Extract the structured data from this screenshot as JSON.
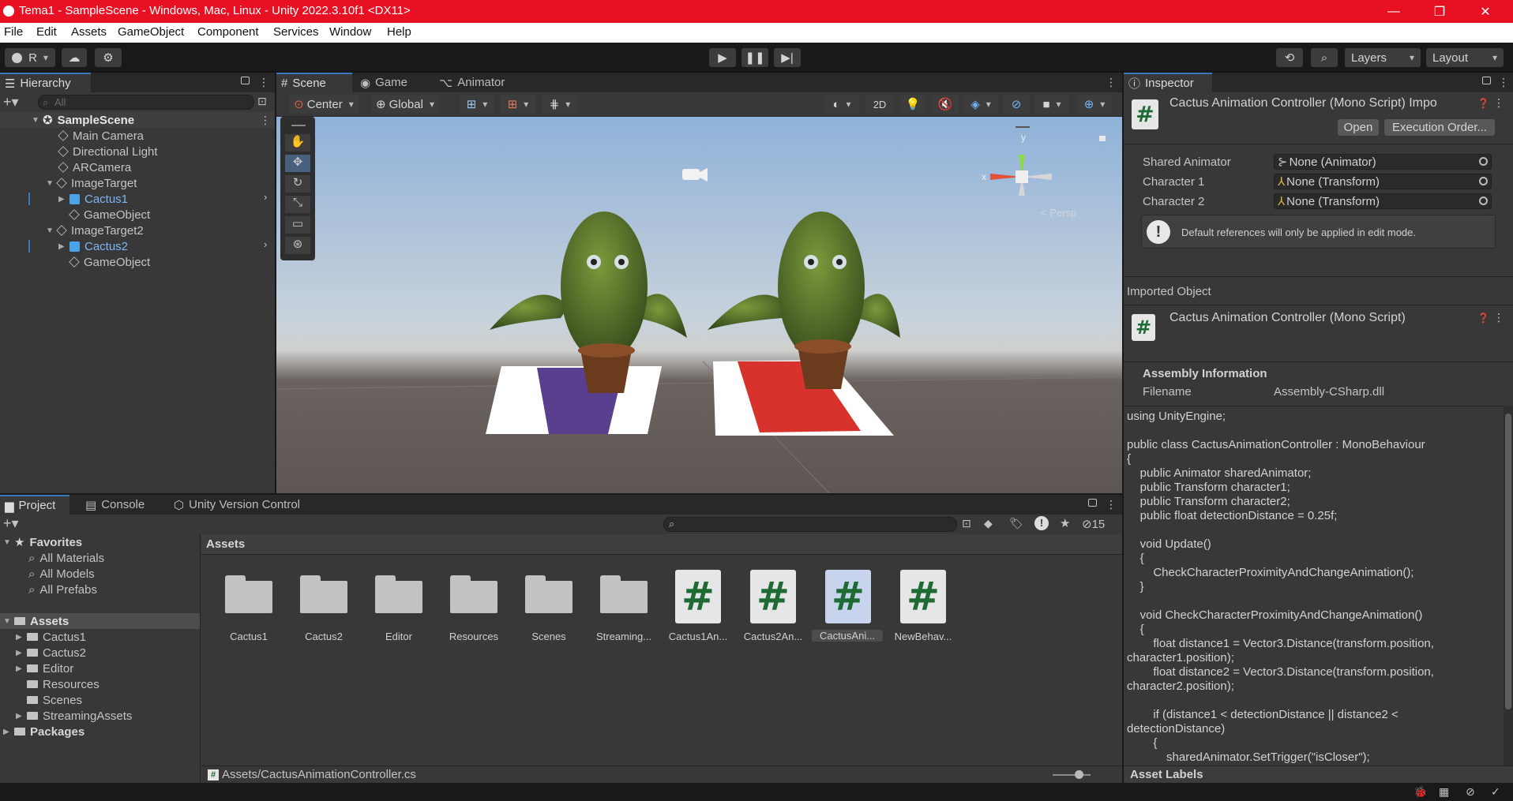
{
  "window": {
    "title": "Tema1 - SampleScene - Windows, Mac, Linux - Unity 2022.3.10f1 <DX11>",
    "minimize": "—",
    "maximize": "❐",
    "close": "✕"
  },
  "menu": [
    "File",
    "Edit",
    "Assets",
    "GameObject",
    "Component",
    "Services",
    "Window",
    "Help"
  ],
  "toolbar": {
    "account": "R",
    "layers": "Layers",
    "layout": "Layout"
  },
  "hierarchy": {
    "tab": "Hierarchy",
    "search_placeholder": "All",
    "items": [
      {
        "label": "SampleScene",
        "depth": 0
      },
      {
        "label": "Main Camera",
        "depth": 2
      },
      {
        "label": "Directional Light",
        "depth": 2
      },
      {
        "label": "ARCamera",
        "depth": 2
      },
      {
        "label": "ImageTarget",
        "depth": 1
      },
      {
        "label": "Cactus1",
        "depth": 2
      },
      {
        "label": "GameObject",
        "depth": 2
      },
      {
        "label": "ImageTarget2",
        "depth": 1
      },
      {
        "label": "Cactus2",
        "depth": 2
      },
      {
        "label": "GameObject",
        "depth": 2
      }
    ]
  },
  "scene": {
    "tabs": [
      "Scene",
      "Game",
      "Animator"
    ],
    "pivot": "Center",
    "space": "Global",
    "mode2d": "2D",
    "persp": "< Persp",
    "gizmo_y": "y",
    "gizmo_x": "x"
  },
  "inspector": {
    "tab": "Inspector",
    "header_title": "Cactus Animation Controller (Mono Script) Impo",
    "open_btn": "Open",
    "exec_btn": "Execution Order...",
    "fields": [
      {
        "label": "Shared Animator",
        "value": "None (Animator)"
      },
      {
        "label": "Character 1",
        "value": "None (Transform)"
      },
      {
        "label": "Character 2",
        "value": "None (Transform)"
      }
    ],
    "help_text": "Default references will only be applied in edit mode.",
    "imported_object": "Imported Object",
    "script_title": "Cactus Animation Controller (Mono Script)",
    "assembly_info": "Assembly Information",
    "filename_label": "Filename",
    "filename_value": "Assembly-CSharp.dll",
    "code": [
      "using UnityEngine;",
      "",
      "public class CactusAnimationController : MonoBehaviour",
      "{",
      "    public Animator sharedAnimator;",
      "    public Transform character1;",
      "    public Transform character2;",
      "    public float detectionDistance = 0.25f;",
      "",
      "    void Update()",
      "    {",
      "        CheckCharacterProximityAndChangeAnimation();",
      "    }",
      "",
      "    void CheckCharacterProximityAndChangeAnimation()",
      "    {",
      "        float distance1 = Vector3.Distance(transform.position,",
      "character1.position);",
      "        float distance2 = Vector3.Distance(transform.position,",
      "character2.position);",
      "",
      "        if (distance1 < detectionDistance || distance2 <",
      "detectionDistance)",
      "        {",
      "            sharedAnimator.SetTrigger(\"isCloser\");"
    ],
    "asset_labels": "Asset Labels"
  },
  "project": {
    "tabs": [
      "Project",
      "Console",
      "Unity Version Control"
    ],
    "hidden_count": "15",
    "favorites": "Favorites",
    "fav_items": [
      "All Materials",
      "All Models",
      "All Prefabs"
    ],
    "assets_root": "Assets",
    "asset_folders": [
      "Cactus1",
      "Cactus2",
      "Editor",
      "Resources",
      "Scenes",
      "StreamingAssets"
    ],
    "packages": "Packages",
    "breadcrumb": "Assets",
    "grid": [
      {
        "label": "Cactus1",
        "kind": "folder"
      },
      {
        "label": "Cactus2",
        "kind": "folder"
      },
      {
        "label": "Editor",
        "kind": "folder"
      },
      {
        "label": "Resources",
        "kind": "folder"
      },
      {
        "label": "Scenes",
        "kind": "folder"
      },
      {
        "label": "Streaming...",
        "kind": "folder"
      },
      {
        "label": "Cactus1An...",
        "kind": "script"
      },
      {
        "label": "Cactus2An...",
        "kind": "script"
      },
      {
        "label": "CactusAni...",
        "kind": "script"
      },
      {
        "label": "NewBehav...",
        "kind": "script"
      }
    ],
    "path": "Assets/CactusAnimationController.cs"
  },
  "colors": {
    "title_bar": "#e81123",
    "accent_blue": "#3a79bb",
    "selection": "#2c5d87",
    "script_green": "#1e6b34"
  }
}
